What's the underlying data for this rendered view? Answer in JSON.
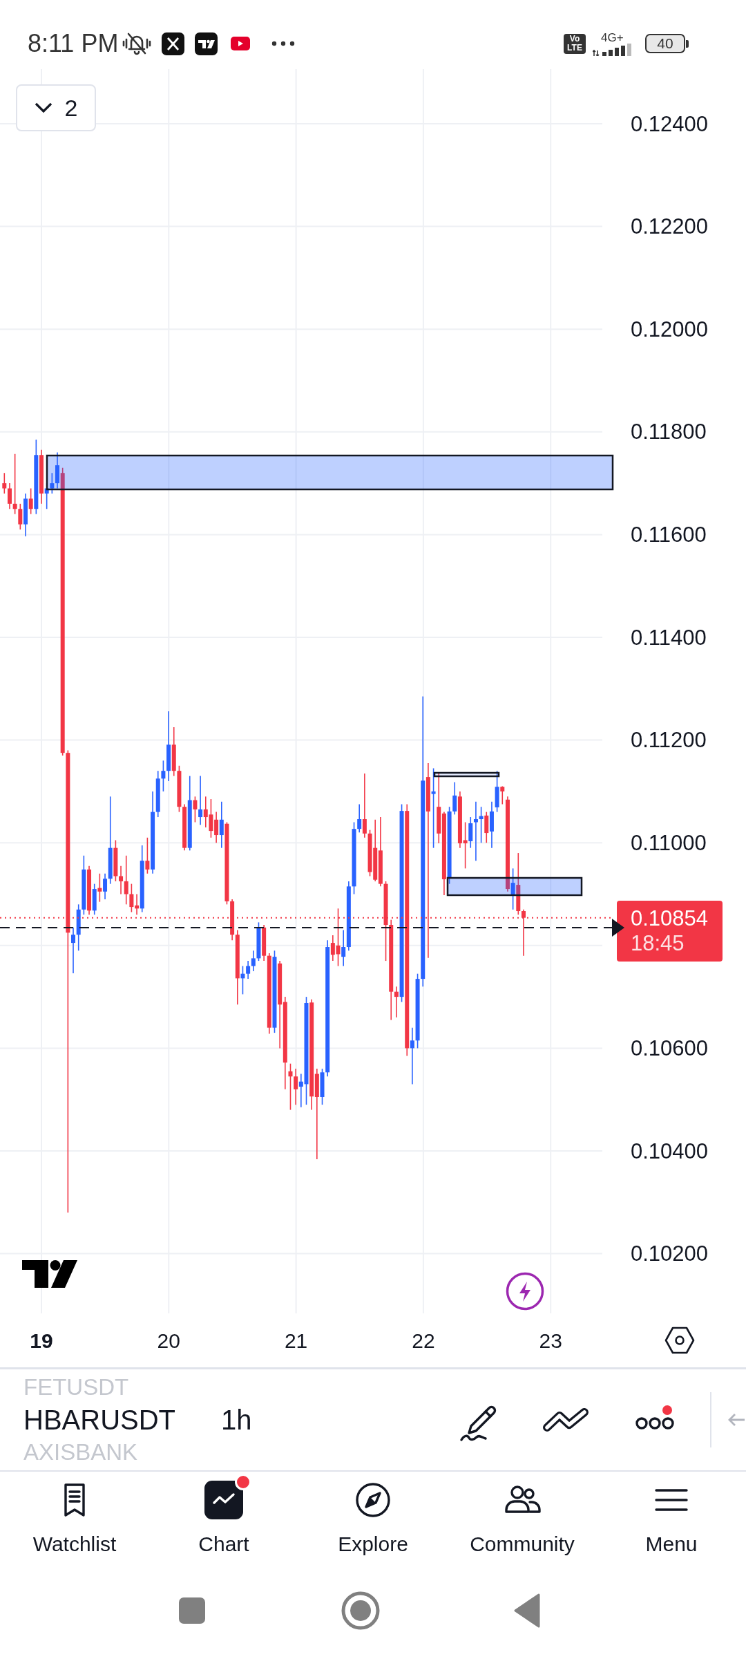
{
  "status_bar": {
    "time": "8:11 PM",
    "volte": "Vo LTE",
    "network": "4G+",
    "battery": "40"
  },
  "chart": {
    "pane_button": {
      "label": "2"
    },
    "price_scale": [
      "0.12400",
      "0.12200",
      "0.12000",
      "0.11800",
      "0.11600",
      "0.11400",
      "0.11200",
      "0.11000",
      "0.10600",
      "0.10400",
      "0.10200"
    ],
    "last_price": {
      "price": "0.10854",
      "countdown": "18:45"
    },
    "time_scale": [
      {
        "label": "19",
        "bold": true
      },
      {
        "label": "20",
        "bold": false
      },
      {
        "label": "21",
        "bold": false
      },
      {
        "label": "22",
        "bold": false
      },
      {
        "label": "23",
        "bold": false
      }
    ]
  },
  "toolbar": {
    "symbols": [
      {
        "label": "FETUSDT",
        "selected": false
      },
      {
        "label": "HBARUSDT",
        "selected": true
      },
      {
        "label": "AXISBANK",
        "selected": false
      }
    ],
    "interval": "1h",
    "more_button": {
      "badge": true
    }
  },
  "bottom_nav": [
    {
      "label": "Watchlist",
      "selected": false,
      "badge": false
    },
    {
      "label": "Chart",
      "selected": true,
      "badge": true
    },
    {
      "label": "Explore",
      "selected": false,
      "badge": false
    },
    {
      "label": "Community",
      "selected": false,
      "badge": false
    },
    {
      "label": "Menu",
      "selected": false,
      "badge": false
    }
  ]
}
